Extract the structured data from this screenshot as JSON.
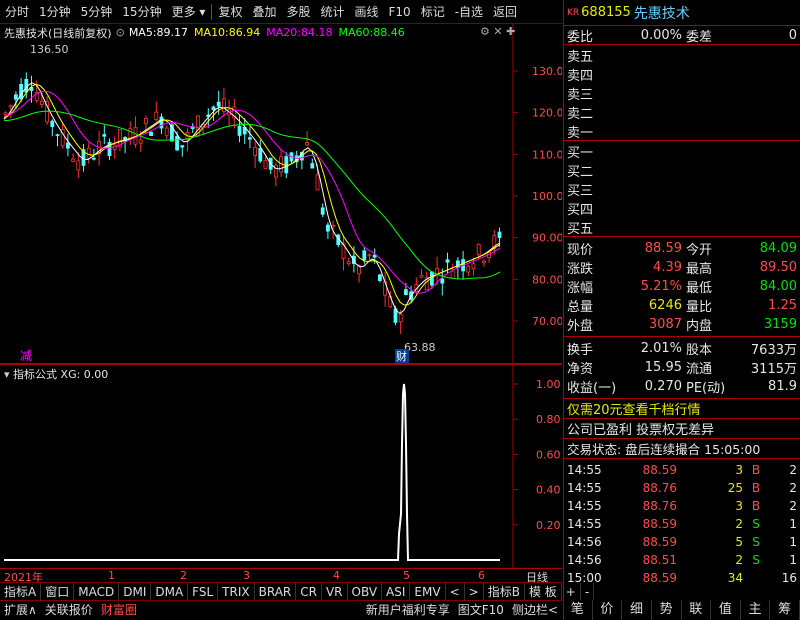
{
  "toolbar": {
    "items": [
      "分时",
      "1分钟",
      "5分钟",
      "15分钟",
      "更多",
      "复权",
      "叠加",
      "多股",
      "统计",
      "画线",
      "F10",
      "标记",
      "-自选",
      "返回"
    ]
  },
  "chart": {
    "title": "先惠技术(日线前复权)",
    "ma": [
      {
        "label": "MA5:",
        "value": "89.17",
        "color": "#ffffff"
      },
      {
        "label": "MA10:",
        "value": "86.94",
        "color": "#ffff00"
      },
      {
        "label": "MA20:",
        "value": "84.18",
        "color": "#ff00ff"
      },
      {
        "label": "MA60:",
        "value": "88.46",
        "color": "#00ff00"
      }
    ],
    "y_ticks": [
      "130.0",
      "120.0",
      "110.0",
      "100.0",
      "90.00",
      "80.00",
      "70.00"
    ],
    "high_label": "136.50",
    "low_label": "63.88",
    "jian_marker": "减",
    "cai_marker": "财"
  },
  "indicator": {
    "title": "指标公式 XG: 0.00",
    "y_ticks": [
      "1.00",
      "0.80",
      "0.60",
      "0.40",
      "0.20"
    ]
  },
  "x_axis": {
    "labels": [
      "2021年",
      "1",
      "2",
      "3",
      "4",
      "5",
      "6"
    ],
    "period": "日线"
  },
  "tabs_row1": [
    "指标A",
    "窗口",
    "MACD",
    "DMI",
    "DMA",
    "FSL",
    "TRIX",
    "BRAR",
    "CR",
    "VR",
    "OBV",
    "ASI",
    "EMV",
    "<",
    ">",
    "指标B",
    "模 板",
    "+",
    "-"
  ],
  "tabs_row2": [
    "扩展∧",
    "关联报价",
    "财富圈",
    "新用户福利专享",
    "图文F10",
    "侧边栏<"
  ],
  "bottom_icons": [
    "笔",
    "价",
    "细",
    "势",
    "联",
    "值",
    "主",
    "筹"
  ],
  "quote": {
    "code": "688155",
    "name": "先惠技术",
    "wb_label": "委比",
    "wb_value": "0.00%",
    "wc_label": "委差",
    "wc_value": "0",
    "sell": [
      "卖五",
      "卖四",
      "卖三",
      "卖二",
      "卖一"
    ],
    "buy": [
      "买一",
      "买二",
      "买三",
      "买四",
      "买五"
    ],
    "stats": [
      {
        "l1": "现价",
        "v1": "88.59",
        "c1": "red",
        "l2": "今开",
        "v2": "84.09",
        "c2": "green"
      },
      {
        "l1": "涨跌",
        "v1": "4.39",
        "c1": "red",
        "l2": "最高",
        "v2": "89.50",
        "c2": "red"
      },
      {
        "l1": "涨幅",
        "v1": "5.21%",
        "c1": "red",
        "l2": "最低",
        "v2": "84.00",
        "c2": "green"
      },
      {
        "l1": "总量",
        "v1": "6246",
        "c1": "yellow",
        "l2": "量比",
        "v2": "1.25",
        "c2": "red"
      },
      {
        "l1": "外盘",
        "v1": "3087",
        "c1": "red",
        "l2": "内盘",
        "v2": "3159",
        "c2": "green"
      }
    ],
    "stats2": [
      {
        "l1": "换手",
        "v1": "2.01%",
        "l2": "股本",
        "v2": "7633万"
      },
      {
        "l1": "净资",
        "v1": "15.95",
        "l2": "流通",
        "v2": "3115万"
      },
      {
        "l1": "收益(一)",
        "v1": "0.270",
        "l2": "PE(动)",
        "v2": "81.9"
      }
    ],
    "promo": "仅需20元查看千档行情",
    "notice": "公司已盈利 投票权无差异",
    "status": "交易状态: 盘后连续撮合 15:05:00",
    "trades": [
      {
        "t": "14:55",
        "p": "88.59",
        "v": "3",
        "d": "B",
        "n": "2"
      },
      {
        "t": "14:55",
        "p": "88.76",
        "v": "25",
        "d": "B",
        "n": "2"
      },
      {
        "t": "14:55",
        "p": "88.76",
        "v": "3",
        "d": "B",
        "n": "2"
      },
      {
        "t": "14:55",
        "p": "88.59",
        "v": "2",
        "d": "S",
        "n": "1"
      },
      {
        "t": "14:56",
        "p": "88.59",
        "v": "5",
        "d": "S",
        "n": "1"
      },
      {
        "t": "14:56",
        "p": "88.51",
        "v": "2",
        "d": "S",
        "n": "1"
      },
      {
        "t": "15:00",
        "p": "88.59",
        "v": "34",
        "d": "",
        "n": "16"
      }
    ]
  }
}
